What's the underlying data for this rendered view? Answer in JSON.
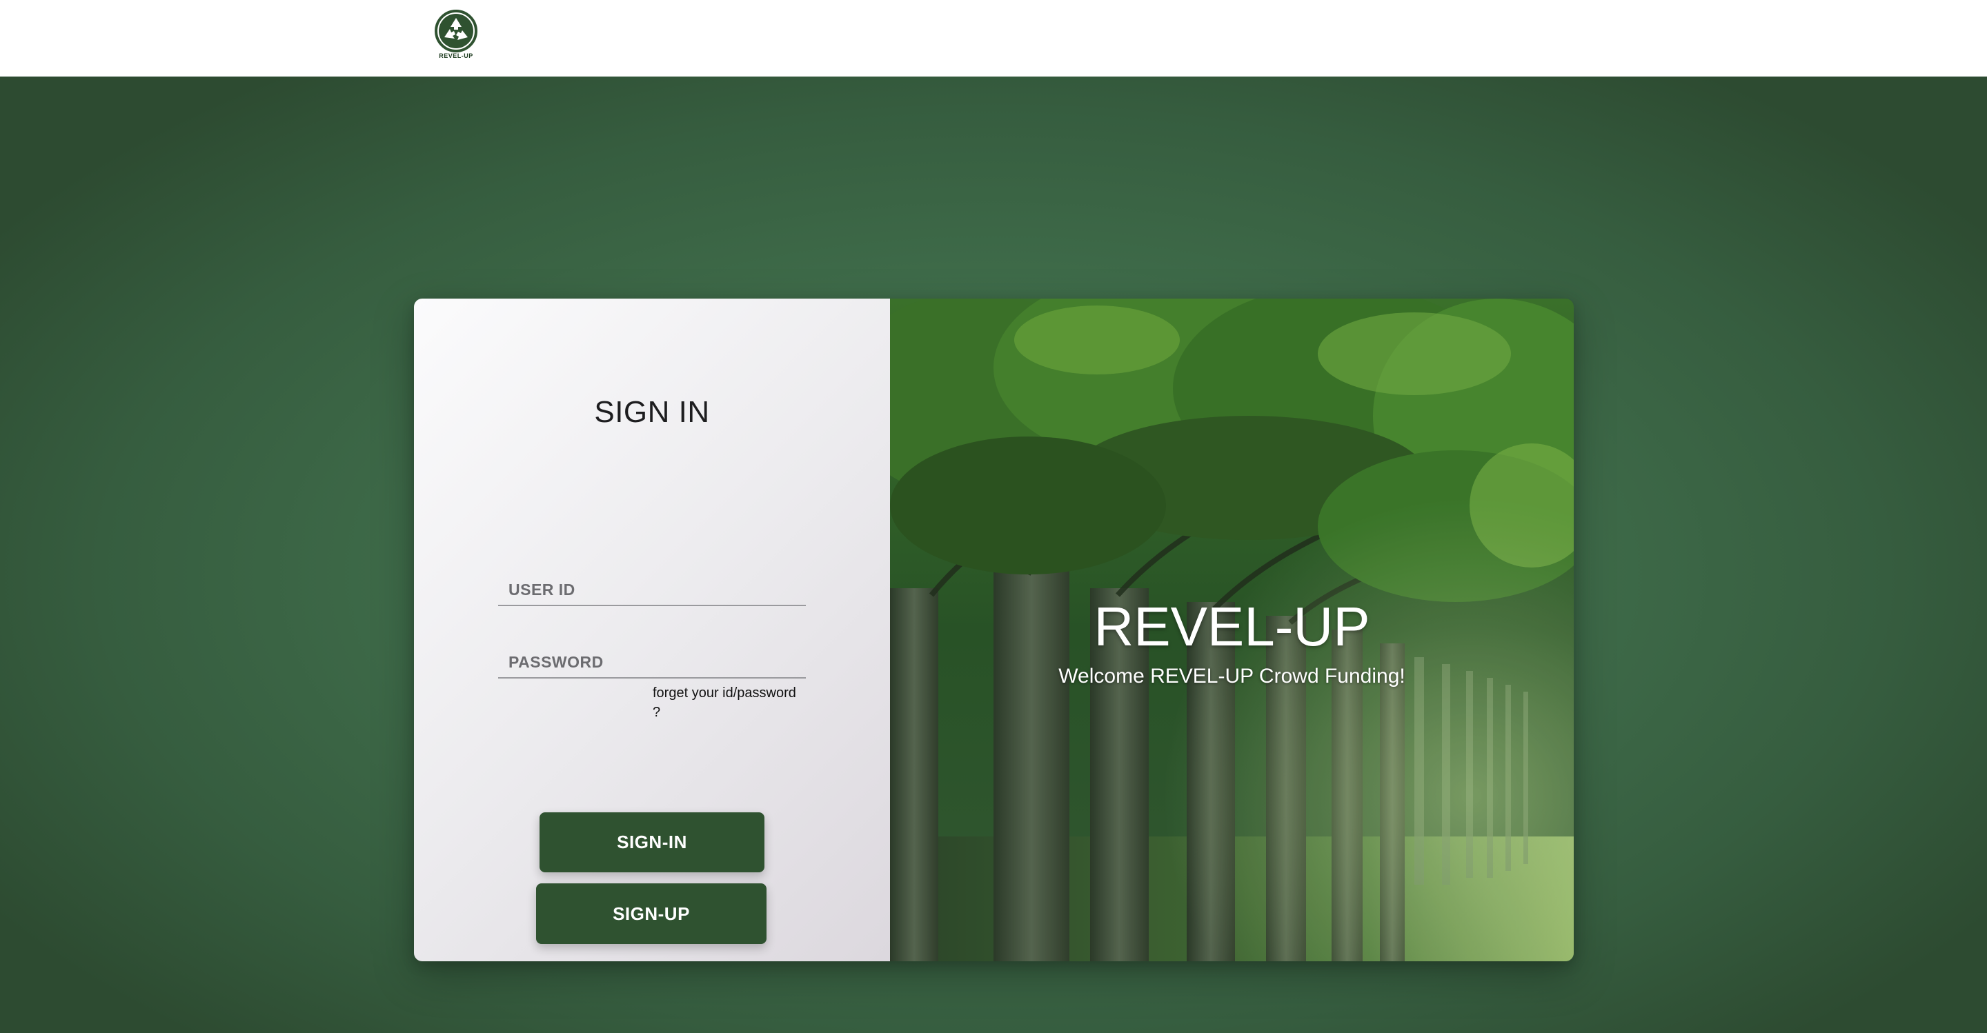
{
  "header": {
    "logo_text": "REVEL-UP"
  },
  "login": {
    "title": "SIGN IN",
    "user_id_placeholder": "USER ID",
    "password_placeholder": "PASSWORD",
    "forgot_line1": "forget your id/password",
    "forgot_line2": "?",
    "signin_label": "SIGN-IN",
    "signup_label": "SIGN-UP"
  },
  "hero": {
    "title": "REVEL-UP",
    "subtitle": "Welcome REVEL-UP Crowd Funding!",
    "image_icon": "forest-trees-image"
  },
  "colors": {
    "brand_green": "#2f5230",
    "background_green": "#3f6c4a",
    "panel_light": "#ecebee"
  }
}
